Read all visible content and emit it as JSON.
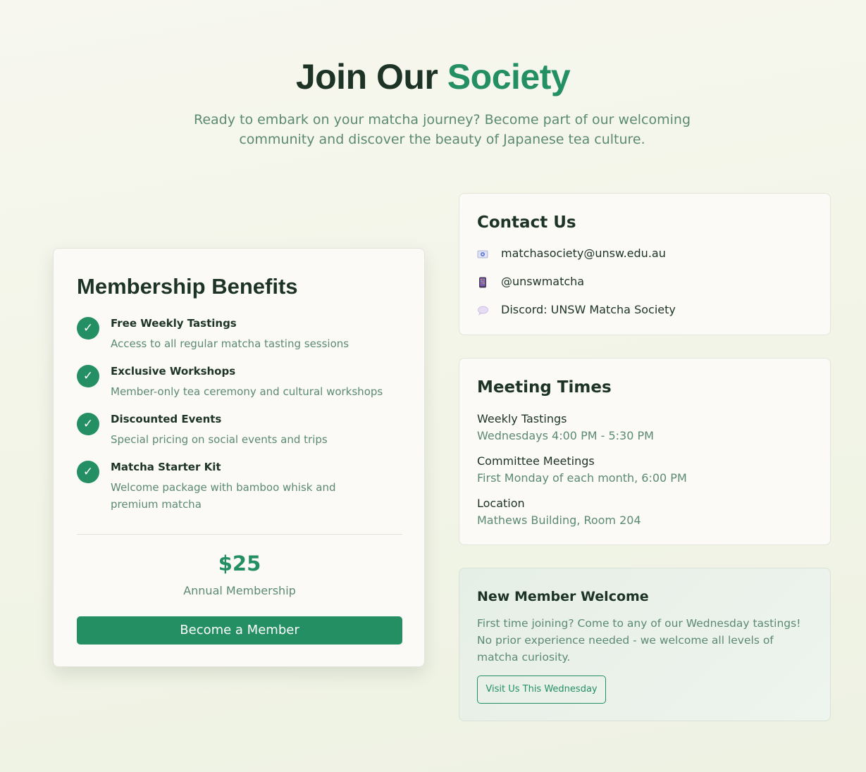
{
  "hero": {
    "title_main": "Join Our ",
    "title_accent": "Society",
    "subtitle": "Ready to embark on your matcha journey? Become part of our welcoming community and discover the beauty of Japanese tea culture."
  },
  "benefits": {
    "title": "Membership Benefits",
    "check_glyph": "✓",
    "items": [
      {
        "title": "Free Weekly Tastings",
        "desc": "Access to all regular matcha tasting sessions"
      },
      {
        "title": "Exclusive Workshops",
        "desc": "Member-only tea ceremony and cultural workshops"
      },
      {
        "title": "Discounted Events",
        "desc": "Special pricing on social events and trips"
      },
      {
        "title": "Matcha Starter Kit",
        "desc": "Welcome package with bamboo whisk and premium matcha"
      }
    ],
    "price": "$25",
    "price_label": "Annual Membership",
    "button_label": "Become a Member"
  },
  "contact": {
    "title": "Contact Us",
    "items": [
      {
        "icon": "email-icon",
        "text": "matchasociety@unsw.edu.au"
      },
      {
        "icon": "instagram-icon",
        "text": "@unswmatcha"
      },
      {
        "icon": "discord-icon",
        "text": "Discord: UNSW Matcha Society"
      }
    ]
  },
  "meeting": {
    "title": "Meeting Times",
    "items": [
      {
        "label": "Weekly Tastings",
        "value": "Wednesdays 4:00 PM - 5:30 PM"
      },
      {
        "label": "Committee Meetings",
        "value": "First Monday of each month, 6:00 PM"
      },
      {
        "label": "Location",
        "value": "Mathews Building, Room 204"
      }
    ]
  },
  "welcome": {
    "title": "New Member Welcome",
    "text": "First time joining? Come to any of our Wednesday tastings! No prior experience needed - we welcome all levels of matcha curiosity.",
    "button_label": "Visit Us This Wednesday"
  },
  "colors": {
    "accent": "#248f63",
    "text_dark": "#1c3326",
    "text_muted": "#5b8a71",
    "background": "#f3f5e9"
  }
}
